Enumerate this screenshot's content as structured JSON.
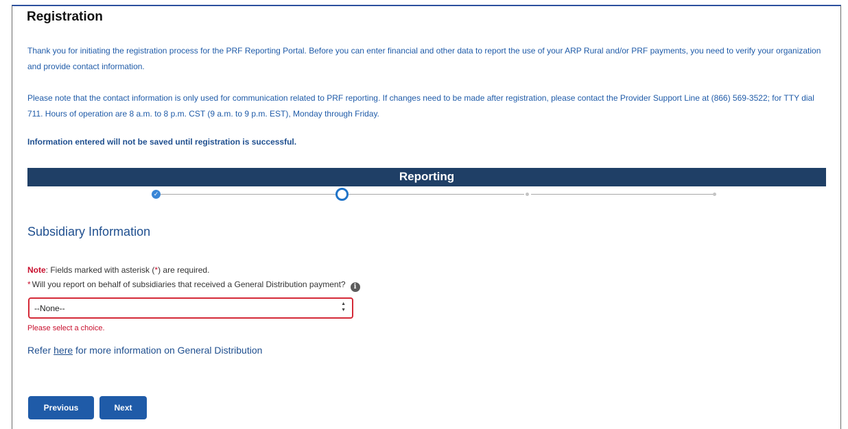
{
  "page": {
    "title": "Registration",
    "intro": "Thank you for initiating the registration process for the PRF Reporting Portal. Before you can enter financial and other data to report the use of your ARP Rural and/or PRF payments, you need to verify your organization and provide contact information.",
    "contact_note": "Please note that the contact information is only used for communication related to PRF reporting. If changes need to be made after registration, please contact the Provider Support Line at (866) 569-3522; for TTY dial 711. Hours of operation are 8 a.m. to 8 p.m. CST (9 a.m. to 9 p.m. EST), Monday through Friday.",
    "save_notice": "Information entered will not be saved until registration is successful."
  },
  "progress": {
    "label": "Reporting",
    "steps": [
      {
        "state": "complete",
        "icon": "check-icon"
      },
      {
        "state": "current"
      },
      {
        "state": "upcoming"
      },
      {
        "state": "upcoming"
      }
    ]
  },
  "form": {
    "section_title": "Subsidiary Information",
    "note_label": "Note",
    "note_text_before": ": Fields marked with asterisk (",
    "note_asterisk": "*",
    "note_text_after": ") are required.",
    "required_marker": "*",
    "question": "Will you report on behalf of subsidiaries that received a General Distribution payment?",
    "info_icon": "info-icon",
    "select_value": "--None--",
    "error": "Please select a choice.",
    "refer_before": "Refer ",
    "refer_link": "here",
    "refer_after": " for more information on General Distribution"
  },
  "buttons": {
    "previous": "Previous",
    "next": "Next"
  },
  "colors": {
    "progress_bar": "#1f3f66",
    "primary_button": "#1f5ba8",
    "error": "#c8102e",
    "body_text": "#1f5ba8"
  }
}
